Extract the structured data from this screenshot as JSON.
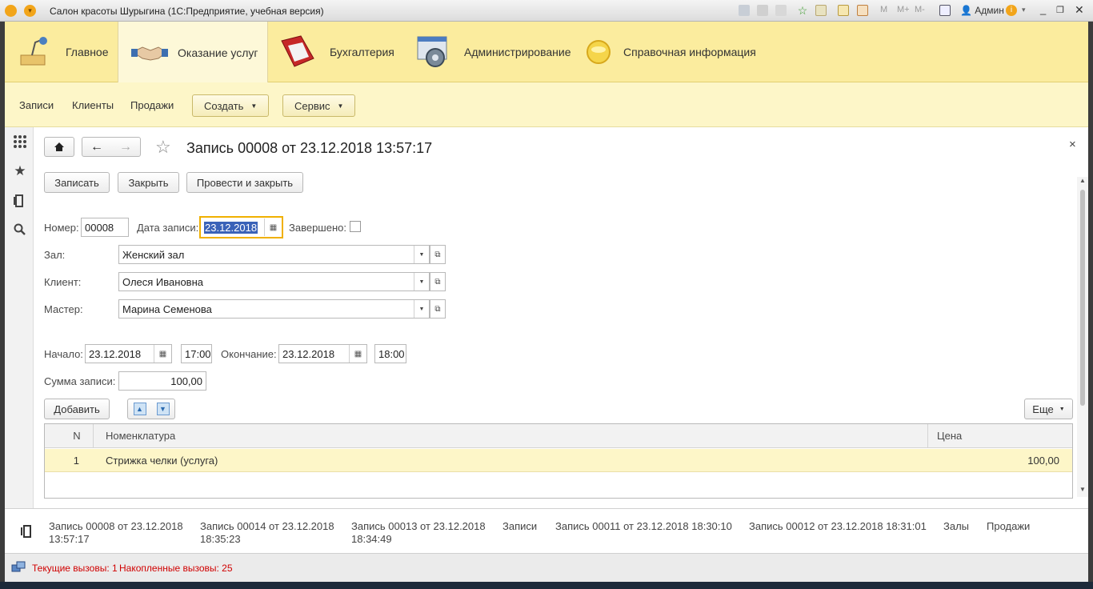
{
  "window": {
    "title": "Салон красоты Шурыгина  (1С:Предприятие, учебная версия)",
    "user": "Админ",
    "memory_buttons": [
      "M",
      "M+",
      "M-"
    ]
  },
  "sections": [
    {
      "label": "Главное"
    },
    {
      "label": "Оказание услуг"
    },
    {
      "label": "Бухгалтерия"
    },
    {
      "label": "Администрирование"
    },
    {
      "label": "Справочная информация"
    }
  ],
  "commands": {
    "links": [
      "Записи",
      "Клиенты",
      "Продажи"
    ],
    "create": "Создать",
    "service": "Сервис"
  },
  "form": {
    "title": "Запись 00008 от 23.12.2018 13:57:17",
    "buttons": {
      "save": "Записать",
      "close": "Закрыть",
      "post_close": "Провести и закрыть"
    },
    "number_label": "Номер:",
    "number": "00008",
    "date_label": "Дата записи:",
    "date": "23.12.2018",
    "completed_label": "Завершено:",
    "hall_label": "Зал:",
    "hall": "Женский зал",
    "client_label": "Клиент:",
    "client": "Олеся Ивановна",
    "master_label": "Мастер:",
    "master": "Марина Семенова",
    "start_label": "Начало:",
    "start_date": "23.12.2018",
    "start_time": "17:00",
    "end_label": "Окончание:",
    "end_date": "23.12.2018",
    "end_time": "18:00",
    "sum_label": "Сумма записи:",
    "sum": "100,00",
    "add_button": "Добавить",
    "more_button": "Еще"
  },
  "table": {
    "columns": [
      "N",
      "Номенклатура",
      "Цена"
    ],
    "rows": [
      {
        "n": "1",
        "item": "Стрижка челки (услуга)",
        "price": "100,00"
      }
    ]
  },
  "open_windows": [
    {
      "line1": "Запись 00008 от 23.12.2018",
      "line2": "13:57:17"
    },
    {
      "line1": "Запись 00014 от 23.12.2018",
      "line2": "18:35:23"
    },
    {
      "line1": "Запись 00013 от 23.12.2018",
      "line2": "18:34:49"
    },
    {
      "line1": "Записи",
      "line2": ""
    },
    {
      "line1": "Запись 00011 от 23.12.2018 18:30:10",
      "line2": ""
    },
    {
      "line1": "Запись 00012 от 23.12.2018 18:31:01",
      "line2": ""
    },
    {
      "line1": "Залы",
      "line2": ""
    },
    {
      "line1": "Продажи",
      "line2": ""
    }
  ],
  "status": {
    "current_calls": "Текущие вызовы: 1",
    "accumulated_calls": "Накопленные вызовы: 25"
  }
}
